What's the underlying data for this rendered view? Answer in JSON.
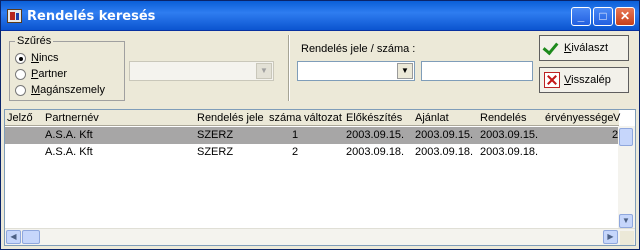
{
  "window": {
    "title": "Rendelés keresés",
    "minimize_glyph": "_",
    "maximize_glyph": "□",
    "close_glyph": "✕"
  },
  "filter": {
    "group_label": "Szűrés",
    "options": [
      {
        "label_first": "N",
        "label_rest": "incs",
        "checked": true
      },
      {
        "label_first": "P",
        "label_rest": "artner",
        "checked": false
      },
      {
        "label_first": "M",
        "label_rest": "agánszemely",
        "checked": false
      }
    ],
    "combo_value": ""
  },
  "order_search": {
    "label": "Rendelés jele / száma :",
    "jel_value": "",
    "szam_value": ""
  },
  "buttons": {
    "select_first": "K",
    "select_rest": "iválaszt",
    "back_first": "V",
    "back_rest": "isszalép"
  },
  "grid": {
    "columns": [
      "Jelző",
      "Partnernév",
      "Rendelés jele",
      "száma",
      "változat",
      "Előkészítés",
      "Ajánlat",
      "Rendelés",
      "érvényessége",
      "V"
    ],
    "rows": [
      {
        "jelzo": "",
        "partner": "A.S.A. Kft",
        "jel": "SZERZ",
        "szama": "1",
        "valtozat": "",
        "elokeszites": "2003.09.15.",
        "ajanlat": "2003.09.15.",
        "rendeles": "2003.09.15.",
        "ervenyesseg": "",
        "v": "2",
        "selected": true
      },
      {
        "jelzo": "",
        "partner": "A.S.A. Kft",
        "jel": "SZERZ",
        "szama": "2",
        "valtozat": "",
        "elokeszites": "2003.09.18.",
        "ajanlat": "2003.09.18.",
        "rendeles": "2003.09.18.",
        "ervenyesseg": "",
        "v": "",
        "selected": false
      }
    ]
  },
  "colors": {
    "titlebar": "#0a5fd8",
    "selected_row": "#a7a6a6",
    "window_bg": "#ece9d8"
  }
}
